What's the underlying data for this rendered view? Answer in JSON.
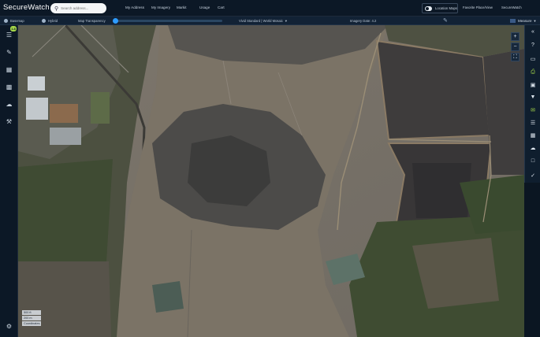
{
  "app": {
    "brand": "SecureWatch"
  },
  "search": {
    "placeholder": "Search address..."
  },
  "nav": {
    "items": [
      "My Address",
      "My Imagery",
      "Markit",
      "Usage",
      "Cart"
    ]
  },
  "header_right": {
    "toggle_label": "Location Maps",
    "link1": "Favorite Place/View",
    "link2": "SecureWatch"
  },
  "toolbar": {
    "item1": "Basemap",
    "item2": "Hybrid",
    "item3": "Map Transparency",
    "feed_label": "Vivid Standard | World Mosaic",
    "date_label": "Imagery Date: 4.2",
    "units_label": "Measure"
  },
  "map": {
    "scale_text": "500 ft",
    "scale_text2": "200 m",
    "coordinates": "Coordinates"
  },
  "sidebar": {
    "badge": "1.8"
  },
  "colors": {
    "accent": "#2e9cff",
    "active_tool": "#a7d94a",
    "nav_bg": "#0c1826"
  }
}
